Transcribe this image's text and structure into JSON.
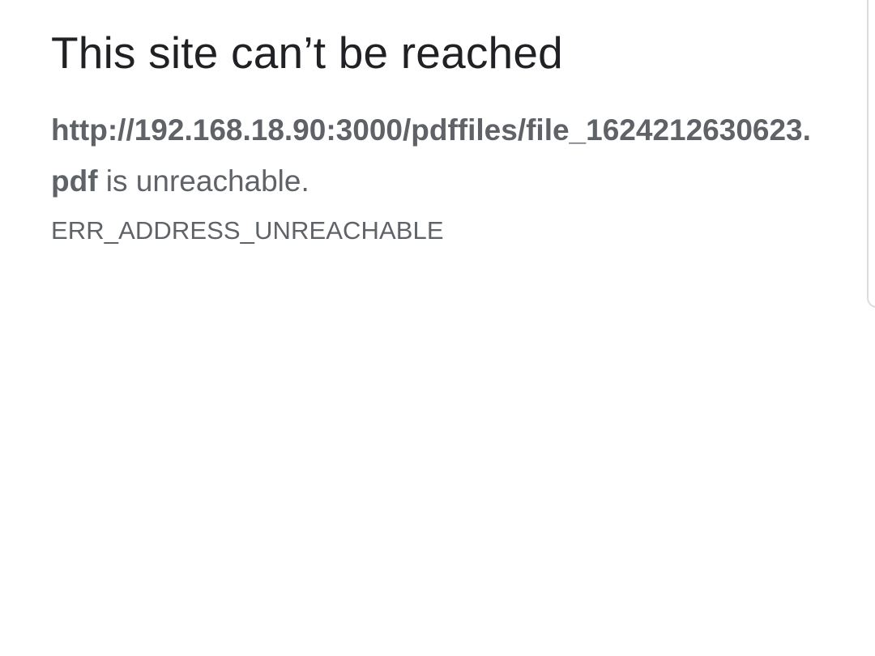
{
  "error_page": {
    "title": "This site can’t be reached",
    "url": "http://192.168.18.90:3000/pdffiles/file_1624212630623.pdf",
    "message_suffix": " is unreachable.",
    "error_code": "ERR_ADDRESS_UNREACHABLE"
  },
  "colors": {
    "title": "#202124",
    "body_text": "#5f6368",
    "background": "#ffffff"
  }
}
